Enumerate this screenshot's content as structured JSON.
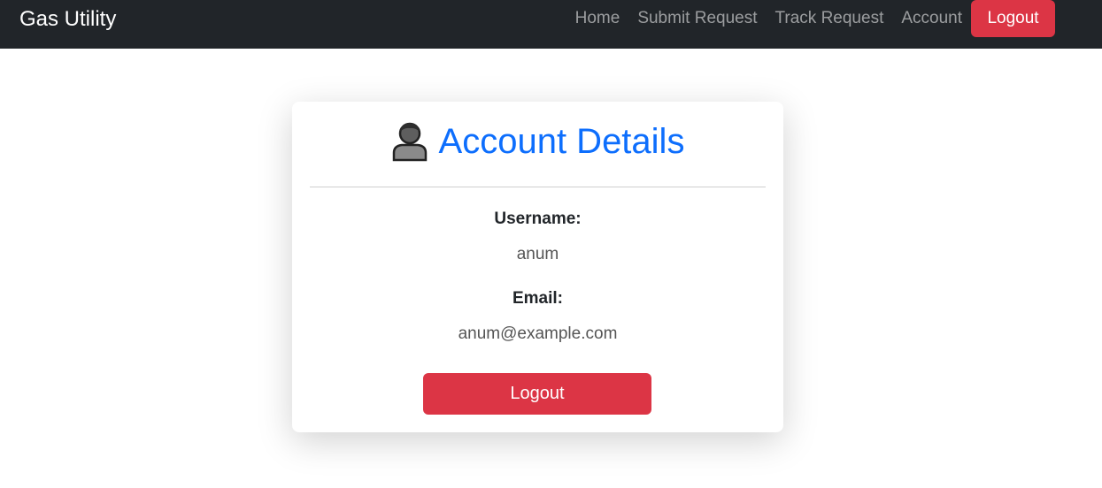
{
  "navbar": {
    "brand": "Gas Utility",
    "links": [
      {
        "label": "Home"
      },
      {
        "label": "Submit Request"
      },
      {
        "label": "Track Request"
      },
      {
        "label": "Account"
      }
    ],
    "logout_label": "Logout"
  },
  "account": {
    "title_icon": "person-icon",
    "title": "Account Details",
    "username_label": "Username:",
    "username_value": "anum",
    "email_label": "Email:",
    "email_value": "anum@example.com",
    "logout_label": "Logout"
  },
  "colors": {
    "navbar_bg": "#212529",
    "primary": "#0d6efd",
    "danger": "#dc3545"
  }
}
